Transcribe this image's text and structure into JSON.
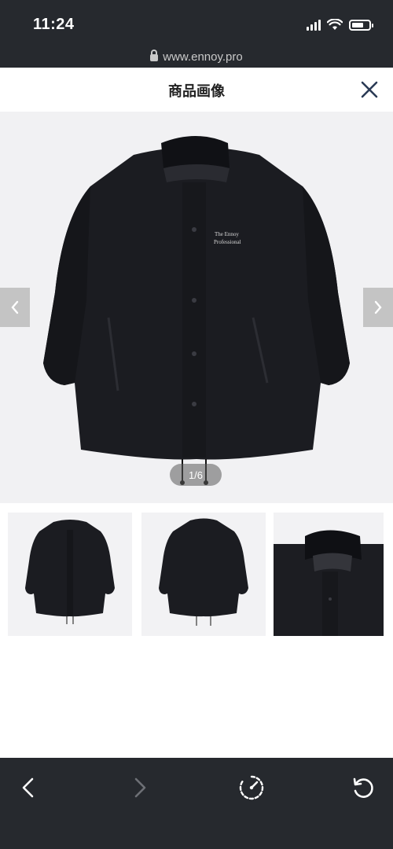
{
  "status_bar": {
    "time": "11:24",
    "icons": [
      "signal-icon",
      "wifi-icon",
      "battery-icon"
    ]
  },
  "browser": {
    "url": "www.ennoy.pro"
  },
  "modal": {
    "title": "商品画像"
  },
  "gallery": {
    "counter": "1/6",
    "current": 1,
    "total": 6,
    "jacket_print_line1": "The Ennoy",
    "jacket_print_line2": "Professional",
    "thumbnails": [
      {
        "view": "front"
      },
      {
        "view": "back"
      },
      {
        "view": "collar-detail"
      }
    ]
  },
  "bottom_nav": {
    "buttons": [
      "back",
      "forward",
      "speed-dial",
      "reload"
    ],
    "forward_enabled": false
  },
  "colors": {
    "chrome_bg": "#26292e",
    "image_bg": "#f1f1f3",
    "jacket": "#1a1b20"
  }
}
